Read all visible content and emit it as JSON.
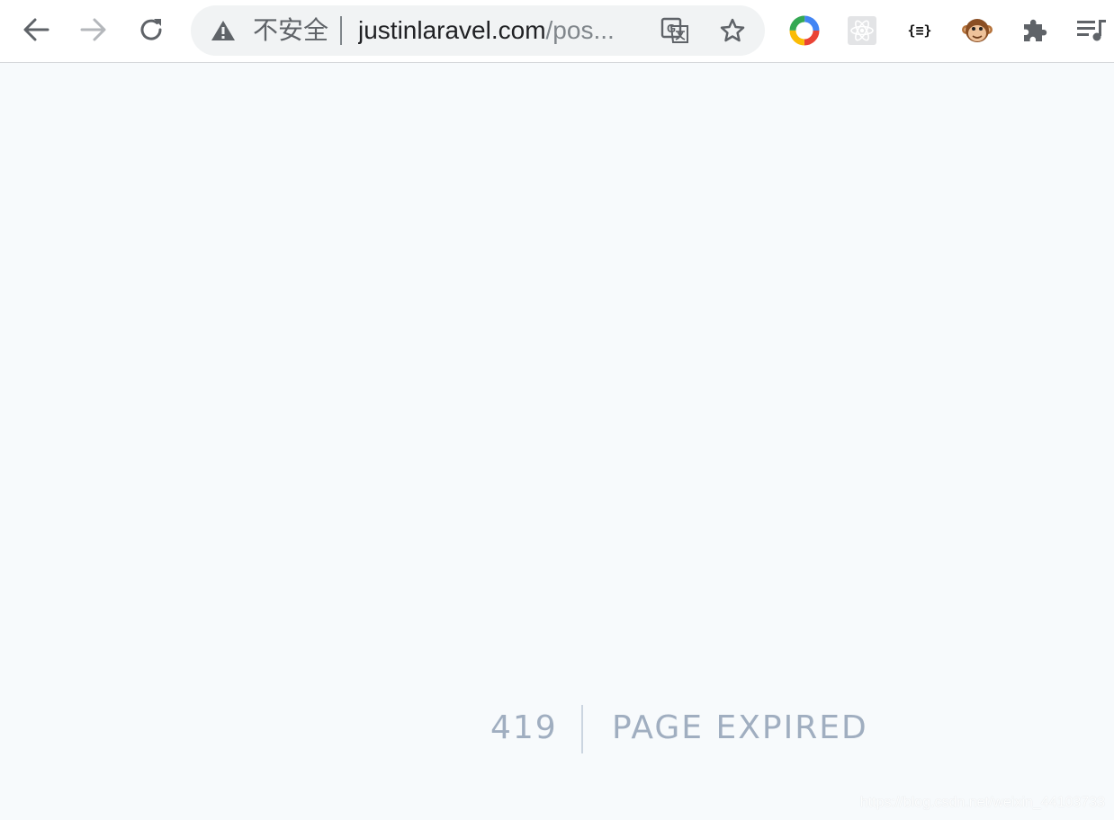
{
  "browser": {
    "security_label": "不安全",
    "url_host": "justinlaravel.com",
    "url_path": "/pos..."
  },
  "icons": {
    "back": "arrow-left-icon",
    "forward": "arrow-right-icon",
    "reload": "reload-icon",
    "warning": "warning-icon",
    "translate": "translate-icon",
    "bookmark": "star-icon",
    "extensions": [
      "color-ring-extension-icon",
      "react-devtools-icon",
      "json-formatter-icon",
      "tampermonkey-icon",
      "puzzle-piece-icon",
      "media-queue-icon"
    ]
  },
  "extensions": {
    "json_label": "{≡}"
  },
  "error": {
    "code": "419",
    "message": "PAGE EXPIRED"
  },
  "watermark": "https://blog.csdn.net/weixin_44103733",
  "colors": {
    "page_bg": "#f7fafc",
    "error_text": "#a0aec0",
    "divider": "#cbd5e0",
    "omnibox_bg": "#f1f3f4"
  }
}
